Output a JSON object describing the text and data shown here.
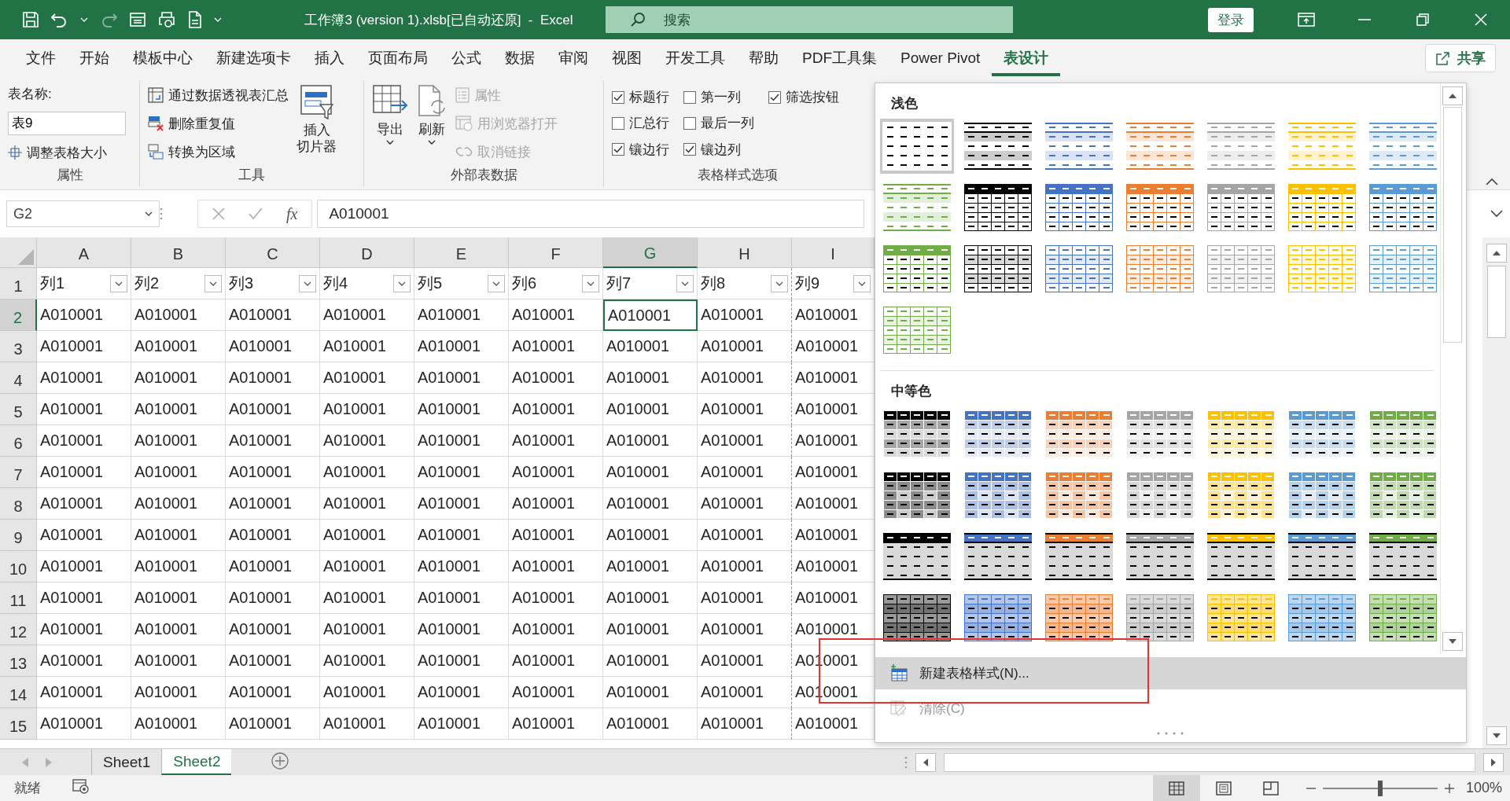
{
  "title_bar": {
    "title": "工作簿3 (version 1).xlsb[已自动还原]  -  Excel",
    "search": {
      "placeholder": "搜索"
    },
    "sign_in": "登录"
  },
  "menu_tabs": [
    {
      "label": "文件",
      "selected": false
    },
    {
      "label": "开始",
      "selected": false
    },
    {
      "label": "模板中心",
      "selected": false
    },
    {
      "label": "新建选项卡",
      "selected": false
    },
    {
      "label": "插入",
      "selected": false
    },
    {
      "label": "页面布局",
      "selected": false
    },
    {
      "label": "公式",
      "selected": false
    },
    {
      "label": "数据",
      "selected": false
    },
    {
      "label": "审阅",
      "selected": false
    },
    {
      "label": "视图",
      "selected": false
    },
    {
      "label": "开发工具",
      "selected": false
    },
    {
      "label": "帮助",
      "selected": false
    },
    {
      "label": "PDF工具集",
      "selected": false
    },
    {
      "label": "Power Pivot",
      "selected": false
    },
    {
      "label": "表设计",
      "selected": true
    }
  ],
  "share": "共享",
  "ribbon": {
    "properties": {
      "name_label": "表名称:",
      "name_value": "表9",
      "resize": "调整表格大小",
      "group": "属性"
    },
    "tools": {
      "items": [
        "通过数据透视表汇总",
        "删除重复值",
        "转换为区域"
      ],
      "slicer_lines": [
        "插入",
        "切片器"
      ],
      "group": "工具"
    },
    "external": {
      "export": "导出",
      "refresh": "刷新",
      "small": [
        {
          "label": "属性",
          "disabled": true
        },
        {
          "label": "用浏览器打开",
          "disabled": true
        },
        {
          "label": "取消链接",
          "disabled": true
        }
      ],
      "group": "外部表数据"
    },
    "style_options": {
      "checkboxes": [
        {
          "label": "标题行",
          "checked": true
        },
        {
          "label": "汇总行",
          "checked": false
        },
        {
          "label": "镶边行",
          "checked": true
        },
        {
          "label": "第一列",
          "checked": false
        },
        {
          "label": "最后一列",
          "checked": false
        },
        {
          "label": "镶边列",
          "checked": true
        },
        {
          "label": "筛选按钮",
          "checked": true
        }
      ],
      "group": "表格样式选项"
    }
  },
  "formula_bar": {
    "name_box": "G2",
    "fx": "fx",
    "formula": "A010001"
  },
  "sheet": {
    "columns": [
      {
        "label": "A",
        "selected": false
      },
      {
        "label": "B",
        "selected": false
      },
      {
        "label": "C",
        "selected": false
      },
      {
        "label": "D",
        "selected": false
      },
      {
        "label": "E",
        "selected": false
      },
      {
        "label": "F",
        "selected": false
      },
      {
        "label": "G",
        "selected": true
      },
      {
        "label": "H",
        "selected": false
      },
      {
        "label": "I",
        "selected": false
      }
    ],
    "header_row": {
      "number": "1",
      "cells": [
        "列1",
        "列2",
        "列3",
        "列4",
        "列5",
        "列6",
        "列7",
        "列8",
        "列9"
      ]
    },
    "rows": [
      {
        "number": "2",
        "selected": true,
        "cells": [
          "A010001",
          "A010001",
          "A010001",
          "A010001",
          "A010001",
          "A010001",
          "A010001",
          "A010001",
          "A010001"
        ]
      },
      {
        "number": "3",
        "selected": false,
        "cells": [
          "A010001",
          "A010001",
          "A010001",
          "A010001",
          "A010001",
          "A010001",
          "A010001",
          "A010001",
          "A010001"
        ]
      },
      {
        "number": "4",
        "selected": false,
        "cells": [
          "A010001",
          "A010001",
          "A010001",
          "A010001",
          "A010001",
          "A010001",
          "A010001",
          "A010001",
          "A010001"
        ]
      },
      {
        "number": "5",
        "selected": false,
        "cells": [
          "A010001",
          "A010001",
          "A010001",
          "A010001",
          "A010001",
          "A010001",
          "A010001",
          "A010001",
          "A010001"
        ]
      },
      {
        "number": "6",
        "selected": false,
        "cells": [
          "A010001",
          "A010001",
          "A010001",
          "A010001",
          "A010001",
          "A010001",
          "A010001",
          "A010001",
          "A010001"
        ]
      },
      {
        "number": "7",
        "selected": false,
        "cells": [
          "A010001",
          "A010001",
          "A010001",
          "A010001",
          "A010001",
          "A010001",
          "A010001",
          "A010001",
          "A010001"
        ]
      },
      {
        "number": "8",
        "selected": false,
        "cells": [
          "A010001",
          "A010001",
          "A010001",
          "A010001",
          "A010001",
          "A010001",
          "A010001",
          "A010001",
          "A010001"
        ]
      },
      {
        "number": "9",
        "selected": false,
        "cells": [
          "A010001",
          "A010001",
          "A010001",
          "A010001",
          "A010001",
          "A010001",
          "A010001",
          "A010001",
          "A010001"
        ]
      },
      {
        "number": "10",
        "selected": false,
        "cells": [
          "A010001",
          "A010001",
          "A010001",
          "A010001",
          "A010001",
          "A010001",
          "A010001",
          "A010001",
          "A010001"
        ]
      },
      {
        "number": "11",
        "selected": false,
        "cells": [
          "A010001",
          "A010001",
          "A010001",
          "A010001",
          "A010001",
          "A010001",
          "A010001",
          "A010001",
          "A010001"
        ]
      },
      {
        "number": "12",
        "selected": false,
        "cells": [
          "A010001",
          "A010001",
          "A010001",
          "A010001",
          "A010001",
          "A010001",
          "A010001",
          "A010001",
          "A010001"
        ]
      },
      {
        "number": "13",
        "selected": false,
        "cells": [
          "A010001",
          "A010001",
          "A010001",
          "A010001",
          "A010001",
          "A010001",
          "A010001",
          "A010001",
          "A010001"
        ]
      },
      {
        "number": "14",
        "selected": false,
        "cells": [
          "A010001",
          "A010001",
          "A010001",
          "A010001",
          "A010001",
          "A010001",
          "A010001",
          "A010001",
          "A010001"
        ]
      },
      {
        "number": "15",
        "selected": false,
        "cells": [
          "A010001",
          "A010001",
          "A010001",
          "A010001",
          "A010001",
          "A010001",
          "A010001",
          "A010001",
          "A010001"
        ]
      }
    ]
  },
  "gallery": {
    "sections": [
      {
        "title": "浅色",
        "styles": [
          {
            "kind": "plain",
            "color": "#000000",
            "selected": true
          },
          {
            "kind": "light-banded",
            "color": "#000000",
            "selected": false
          },
          {
            "kind": "light-banded",
            "color": "#4472c4",
            "selected": false
          },
          {
            "kind": "light-banded",
            "color": "#ed7d31",
            "selected": false
          },
          {
            "kind": "light-banded",
            "color": "#a5a5a5",
            "selected": false
          },
          {
            "kind": "light-banded",
            "color": "#ffc000",
            "selected": false
          },
          {
            "kind": "light-banded",
            "color": "#5b9bd5",
            "selected": false
          },
          {
            "kind": "light-banded",
            "color": "#70ad47",
            "selected": false
          },
          {
            "kind": "light-header",
            "color": "#000000",
            "selected": false
          },
          {
            "kind": "light-header",
            "color": "#4472c4",
            "selected": false
          },
          {
            "kind": "light-header",
            "color": "#ed7d31",
            "selected": false
          },
          {
            "kind": "light-header",
            "color": "#a5a5a5",
            "selected": false
          },
          {
            "kind": "light-header",
            "color": "#ffc000",
            "selected": false
          },
          {
            "kind": "light-header",
            "color": "#5b9bd5",
            "selected": false
          },
          {
            "kind": "light-header",
            "color": "#70ad47",
            "selected": false
          },
          {
            "kind": "light-grid",
            "color": "#000000",
            "selected": false
          },
          {
            "kind": "light-grid",
            "color": "#4472c4",
            "selected": false
          },
          {
            "kind": "light-grid",
            "color": "#ed7d31",
            "selected": false
          },
          {
            "kind": "light-grid",
            "color": "#a5a5a5",
            "selected": false
          },
          {
            "kind": "light-grid",
            "color": "#ffc000",
            "selected": false
          },
          {
            "kind": "light-grid",
            "color": "#5b9bd5",
            "selected": false
          },
          {
            "kind": "light-grid",
            "color": "#70ad47",
            "selected": false
          }
        ]
      },
      {
        "title": "中等色",
        "styles": [
          {
            "kind": "medium-banded",
            "color": "#000000",
            "selected": false
          },
          {
            "kind": "medium-banded",
            "color": "#4472c4",
            "selected": false
          },
          {
            "kind": "medium-banded",
            "color": "#ed7d31",
            "selected": false
          },
          {
            "kind": "medium-banded",
            "color": "#a5a5a5",
            "selected": false
          },
          {
            "kind": "medium-banded",
            "color": "#ffc000",
            "selected": false
          },
          {
            "kind": "medium-banded",
            "color": "#5b9bd5",
            "selected": false
          },
          {
            "kind": "medium-banded",
            "color": "#70ad47",
            "selected": false
          },
          {
            "kind": "medium-grid",
            "color": "#000000",
            "selected": false
          },
          {
            "kind": "medium-grid",
            "color": "#4472c4",
            "selected": false
          },
          {
            "kind": "medium-grid",
            "color": "#ed7d31",
            "selected": false
          },
          {
            "kind": "medium-grid",
            "color": "#a5a5a5",
            "selected": false
          },
          {
            "kind": "medium-grid",
            "color": "#ffc000",
            "selected": false
          },
          {
            "kind": "medium-grid",
            "color": "#5b9bd5",
            "selected": false
          },
          {
            "kind": "medium-grid",
            "color": "#70ad47",
            "selected": false
          },
          {
            "kind": "medium-dark",
            "color": "#000000",
            "selected": false
          },
          {
            "kind": "medium-dark",
            "color": "#4472c4",
            "selected": false
          },
          {
            "kind": "medium-dark",
            "color": "#ed7d31",
            "selected": false
          },
          {
            "kind": "medium-dark",
            "color": "#a5a5a5",
            "selected": false
          },
          {
            "kind": "medium-dark",
            "color": "#ffc000",
            "selected": false
          },
          {
            "kind": "medium-dark",
            "color": "#5b9bd5",
            "selected": false
          },
          {
            "kind": "medium-dark",
            "color": "#70ad47",
            "selected": false
          },
          {
            "kind": "medium-fill",
            "color": "#000000",
            "selected": false
          },
          {
            "kind": "medium-fill",
            "color": "#4472c4",
            "selected": false
          },
          {
            "kind": "medium-fill",
            "color": "#ed7d31",
            "selected": false
          },
          {
            "kind": "medium-fill",
            "color": "#a5a5a5",
            "selected": false
          },
          {
            "kind": "medium-fill",
            "color": "#ffc000",
            "selected": false
          },
          {
            "kind": "medium-fill",
            "color": "#5b9bd5",
            "selected": false
          },
          {
            "kind": "medium-fill",
            "color": "#70ad47",
            "selected": false
          }
        ]
      }
    ],
    "actions": [
      {
        "kind": "new",
        "label": "新建表格样式(N)...",
        "hovered": true,
        "disabled": false
      },
      {
        "kind": "clear",
        "label": "清除(C)",
        "hovered": false,
        "disabled": true
      }
    ]
  },
  "sheet_tabs": [
    {
      "label": "Sheet1",
      "selected": false
    },
    {
      "label": "Sheet2",
      "selected": true
    }
  ],
  "status": {
    "text": "就绪",
    "views": [
      {
        "kind": "normal",
        "selected": true
      },
      {
        "kind": "page-layout",
        "selected": false
      },
      {
        "kind": "page-break",
        "selected": false
      }
    ],
    "zoom": {
      "level": 0.5,
      "reading": "100%"
    }
  }
}
